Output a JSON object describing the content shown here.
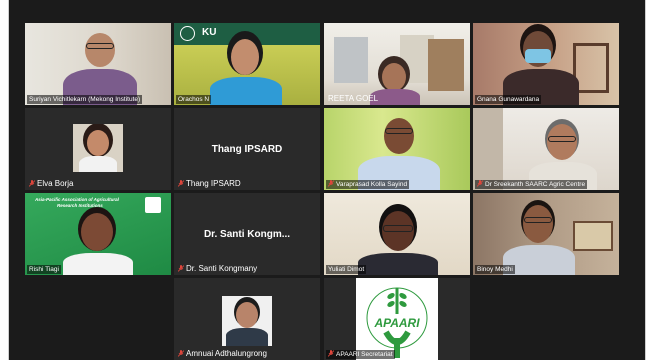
{
  "participants": [
    {
      "name": "Suriyan Vichitlekarn (Mekong Institute)",
      "muted": false
    },
    {
      "name": "Orachos N",
      "muted": false,
      "logo": "KU"
    },
    {
      "name": "REETA GOEL",
      "muted": false
    },
    {
      "name": "Gnana Gunawardana",
      "muted": false
    },
    {
      "name": "Elva Borja",
      "muted": true
    },
    {
      "name": "Thang IPSARD",
      "muted": true,
      "center_label": "Thang IPSARD"
    },
    {
      "name": "Varaprasad Kolla Sayind",
      "muted": true
    },
    {
      "name": "Dr Sreekanth SAARC Agric Centre",
      "muted": true
    },
    {
      "name": "Rishi Tiagi",
      "muted": false,
      "banner_line1": "Asia-Pacific Association of Agricultural",
      "banner_line2": "Research Institutions"
    },
    {
      "name": "Dr. Santi Kongmany",
      "muted": true,
      "center_label": "Dr. Santi Kongm..."
    },
    {
      "name": "Yuliati Dimot",
      "muted": false
    },
    {
      "name": "Binoy Medhi",
      "muted": false
    },
    {
      "name": "Amnuai Adthalungrong",
      "muted": true
    },
    {
      "name": "APAARI Secretariat",
      "muted": true,
      "logo": "APAARI",
      "logo_arc": "Asia-Pacific Association of Agricultural Research Institutions"
    }
  ],
  "colors": {
    "mute": "#e0463c",
    "active_border": "#e6e64a",
    "apaari_green": "#2e9a3e"
  }
}
